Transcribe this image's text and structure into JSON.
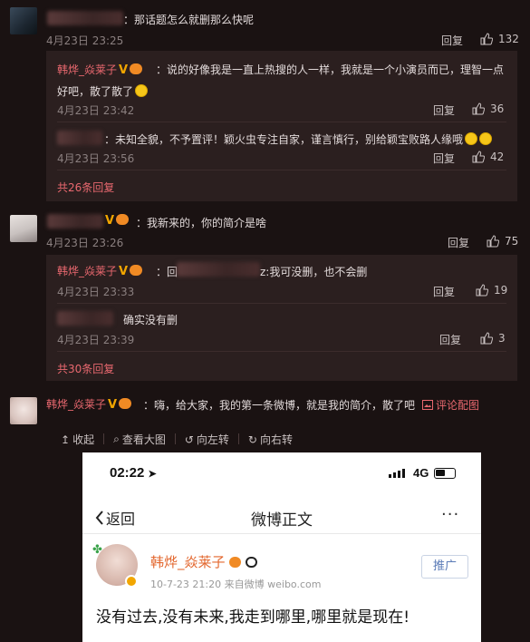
{
  "comments": [
    {
      "text": "：那话题怎么就删那么快呢",
      "time": "4月23日 23:25",
      "reply_label": "回复",
      "likes": "132",
      "replies": [
        {
          "name": "韩烨_焱莱子",
          "text": "：说的好像我是一直上热搜的人一样，我就是一个小演员而已，理智一点",
          "text2": "好吧，散了散了",
          "time": "4月23日 23:42",
          "reply_label": "回复",
          "likes": "36"
        },
        {
          "text": "：未知全貌，不予置评！颖火虫专注自家，谨言慎行，别给颖宝败路人缘哦",
          "time": "4月23日 23:56",
          "reply_label": "回复",
          "likes": "42"
        }
      ],
      "more": "共26条回复"
    },
    {
      "text": "：我新来的，你的简介是啥",
      "time": "4月23日 23:26",
      "reply_label": "回复",
      "likes": "75",
      "replies": [
        {
          "name": "韩烨_焱莱子",
          "prefix": "：回",
          "text": "z:我可没删，也不会删",
          "time": "4月23日 23:33",
          "reply_label": "回复",
          "likes": "19"
        },
        {
          "text": "确实没有删",
          "time": "4月23日 23:39",
          "reply_label": "回复",
          "likes": "3"
        }
      ],
      "more": "共30条回复"
    },
    {
      "name": "韩烨_焱莱子",
      "text": "：嗨，给大家，我的第一条微博，就是我的简介，散了吧",
      "image_link": "评论配图"
    }
  ],
  "toolbar": {
    "collapse": "收起",
    "view_large": "查看大图",
    "rotate_left": "向左转",
    "rotate_right": "向右转"
  },
  "phone": {
    "clock": "02:22",
    "network": "4G",
    "back": "返回",
    "title": "微博正文",
    "more": "···",
    "name": "韩烨_焱莱子",
    "meta": "10-7-23 21:20  来自微博 weibo.com",
    "promote": "推广",
    "content": "没有过去,没有未来,我走到哪里,哪里就是现在!"
  },
  "colors": {
    "background": "#1a1212",
    "reply_box": "#2b1f1f",
    "name": "#e9686f",
    "badge": "#f2a600",
    "phone_name": "#e3672e"
  }
}
